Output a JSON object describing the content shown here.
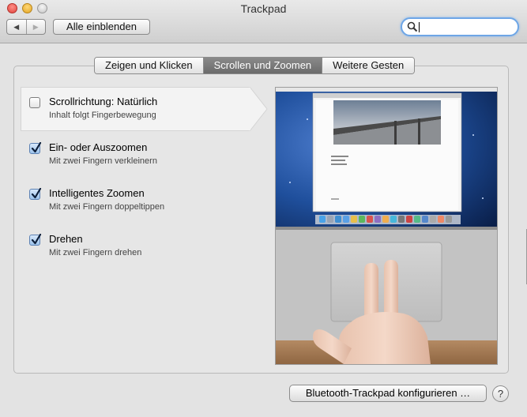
{
  "window": {
    "title": "Trackpad"
  },
  "toolbar": {
    "back_label": "◀",
    "forward_label": "▶",
    "show_all_label": "Alle einblenden",
    "search_value": ""
  },
  "tabs": [
    {
      "label": "Zeigen und Klicken",
      "active": false
    },
    {
      "label": "Scrollen und Zoomen",
      "active": true
    },
    {
      "label": "Weitere Gesten",
      "active": false
    }
  ],
  "options": [
    {
      "title": "Scrollrichtung: Natürlich",
      "subtitle": "Inhalt folgt Fingerbewegung",
      "checked": false,
      "selected": true
    },
    {
      "title": "Ein- oder Auszoomen",
      "subtitle": "Mit zwei Fingern verkleinern",
      "checked": true,
      "selected": false
    },
    {
      "title": "Intelligentes Zoomen",
      "subtitle": "Mit zwei Fingern doppeltippen",
      "checked": true,
      "selected": false
    },
    {
      "title": "Drehen",
      "subtitle": "Mit zwei Fingern drehen",
      "checked": true,
      "selected": false
    }
  ],
  "footer": {
    "bluetooth_button": "Bluetooth-Trackpad konfigurieren …",
    "help_label": "?"
  },
  "colors": {
    "active_tab": "#7a7a7a",
    "checkbox_checked": "#9dc3ec",
    "search_focus": "#6ea6e6",
    "desktop_blue": "#1f4f9c"
  }
}
